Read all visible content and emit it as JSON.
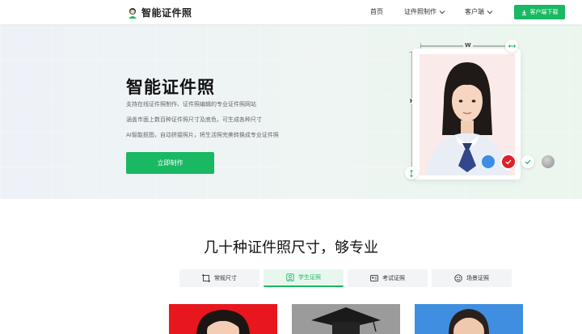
{
  "header": {
    "logo_text": "智能证件照",
    "nav": [
      {
        "label": "首页",
        "has_dropdown": false
      },
      {
        "label": "证件照制作",
        "has_dropdown": true
      },
      {
        "label": "客户端",
        "has_dropdown": true
      }
    ],
    "download_label": "客户端下载",
    "icon": "download-icon"
  },
  "hero": {
    "title": "智能证件照",
    "lines": [
      "支持在线证件照制作、证件照编辑的专业证件照网站",
      "涵盖市面上数百种证件照尺寸及底色，可生成各种尺寸",
      "AI智能抠图，自动拼接照片，将生活照完美转换成专业证件照"
    ],
    "cta_label": "立即制作",
    "dimension_w": "W",
    "dimension_h": "H",
    "swatches": [
      {
        "name": "blue",
        "color": "#3a8ee6"
      },
      {
        "name": "red",
        "color": "#e0202a",
        "selected": true
      },
      {
        "name": "white",
        "color": "#ffffff"
      },
      {
        "name": "gray",
        "color": "#a8a8a8"
      }
    ]
  },
  "section": {
    "title": "几十种证件照尺寸，够专业",
    "tabs": [
      {
        "label": "常规尺寸",
        "icon": "crop-icon",
        "active": false
      },
      {
        "label": "学生证照",
        "icon": "portrait-icon",
        "active": true
      },
      {
        "label": "考试证照",
        "icon": "id-card-icon",
        "active": false
      },
      {
        "label": "场景证照",
        "icon": "scene-icon",
        "active": false
      }
    ],
    "samples": [
      {
        "name": "sample-red-bg",
        "bg": "#e8161d"
      },
      {
        "name": "sample-graduation",
        "bg": "#9a9a9a"
      },
      {
        "name": "sample-blue-bg",
        "bg": "#3f8ee0"
      }
    ]
  },
  "colors": {
    "accent": "#19b862"
  }
}
